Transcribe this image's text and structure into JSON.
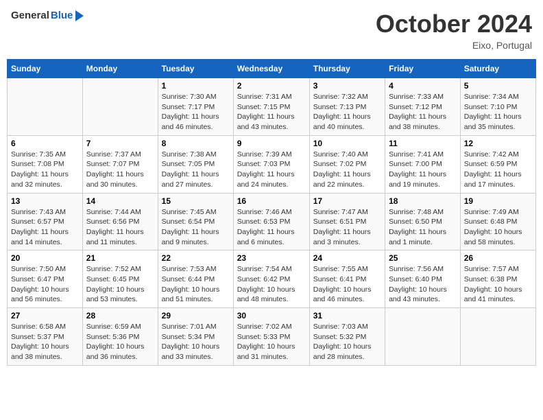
{
  "header": {
    "logo_general": "General",
    "logo_blue": "Blue",
    "title": "October 2024",
    "location": "Eixo, Portugal"
  },
  "columns": [
    "Sunday",
    "Monday",
    "Tuesday",
    "Wednesday",
    "Thursday",
    "Friday",
    "Saturday"
  ],
  "weeks": [
    [
      {
        "day": "",
        "sunrise": "",
        "sunset": "",
        "daylight": ""
      },
      {
        "day": "",
        "sunrise": "",
        "sunset": "",
        "daylight": ""
      },
      {
        "day": "1",
        "sunrise": "Sunrise: 7:30 AM",
        "sunset": "Sunset: 7:17 PM",
        "daylight": "Daylight: 11 hours and 46 minutes."
      },
      {
        "day": "2",
        "sunrise": "Sunrise: 7:31 AM",
        "sunset": "Sunset: 7:15 PM",
        "daylight": "Daylight: 11 hours and 43 minutes."
      },
      {
        "day": "3",
        "sunrise": "Sunrise: 7:32 AM",
        "sunset": "Sunset: 7:13 PM",
        "daylight": "Daylight: 11 hours and 40 minutes."
      },
      {
        "day": "4",
        "sunrise": "Sunrise: 7:33 AM",
        "sunset": "Sunset: 7:12 PM",
        "daylight": "Daylight: 11 hours and 38 minutes."
      },
      {
        "day": "5",
        "sunrise": "Sunrise: 7:34 AM",
        "sunset": "Sunset: 7:10 PM",
        "daylight": "Daylight: 11 hours and 35 minutes."
      }
    ],
    [
      {
        "day": "6",
        "sunrise": "Sunrise: 7:35 AM",
        "sunset": "Sunset: 7:08 PM",
        "daylight": "Daylight: 11 hours and 32 minutes."
      },
      {
        "day": "7",
        "sunrise": "Sunrise: 7:37 AM",
        "sunset": "Sunset: 7:07 PM",
        "daylight": "Daylight: 11 hours and 30 minutes."
      },
      {
        "day": "8",
        "sunrise": "Sunrise: 7:38 AM",
        "sunset": "Sunset: 7:05 PM",
        "daylight": "Daylight: 11 hours and 27 minutes."
      },
      {
        "day": "9",
        "sunrise": "Sunrise: 7:39 AM",
        "sunset": "Sunset: 7:03 PM",
        "daylight": "Daylight: 11 hours and 24 minutes."
      },
      {
        "day": "10",
        "sunrise": "Sunrise: 7:40 AM",
        "sunset": "Sunset: 7:02 PM",
        "daylight": "Daylight: 11 hours and 22 minutes."
      },
      {
        "day": "11",
        "sunrise": "Sunrise: 7:41 AM",
        "sunset": "Sunset: 7:00 PM",
        "daylight": "Daylight: 11 hours and 19 minutes."
      },
      {
        "day": "12",
        "sunrise": "Sunrise: 7:42 AM",
        "sunset": "Sunset: 6:59 PM",
        "daylight": "Daylight: 11 hours and 17 minutes."
      }
    ],
    [
      {
        "day": "13",
        "sunrise": "Sunrise: 7:43 AM",
        "sunset": "Sunset: 6:57 PM",
        "daylight": "Daylight: 11 hours and 14 minutes."
      },
      {
        "day": "14",
        "sunrise": "Sunrise: 7:44 AM",
        "sunset": "Sunset: 6:56 PM",
        "daylight": "Daylight: 11 hours and 11 minutes."
      },
      {
        "day": "15",
        "sunrise": "Sunrise: 7:45 AM",
        "sunset": "Sunset: 6:54 PM",
        "daylight": "Daylight: 11 hours and 9 minutes."
      },
      {
        "day": "16",
        "sunrise": "Sunrise: 7:46 AM",
        "sunset": "Sunset: 6:53 PM",
        "daylight": "Daylight: 11 hours and 6 minutes."
      },
      {
        "day": "17",
        "sunrise": "Sunrise: 7:47 AM",
        "sunset": "Sunset: 6:51 PM",
        "daylight": "Daylight: 11 hours and 3 minutes."
      },
      {
        "day": "18",
        "sunrise": "Sunrise: 7:48 AM",
        "sunset": "Sunset: 6:50 PM",
        "daylight": "Daylight: 11 hours and 1 minute."
      },
      {
        "day": "19",
        "sunrise": "Sunrise: 7:49 AM",
        "sunset": "Sunset: 6:48 PM",
        "daylight": "Daylight: 10 hours and 58 minutes."
      }
    ],
    [
      {
        "day": "20",
        "sunrise": "Sunrise: 7:50 AM",
        "sunset": "Sunset: 6:47 PM",
        "daylight": "Daylight: 10 hours and 56 minutes."
      },
      {
        "day": "21",
        "sunrise": "Sunrise: 7:52 AM",
        "sunset": "Sunset: 6:45 PM",
        "daylight": "Daylight: 10 hours and 53 minutes."
      },
      {
        "day": "22",
        "sunrise": "Sunrise: 7:53 AM",
        "sunset": "Sunset: 6:44 PM",
        "daylight": "Daylight: 10 hours and 51 minutes."
      },
      {
        "day": "23",
        "sunrise": "Sunrise: 7:54 AM",
        "sunset": "Sunset: 6:42 PM",
        "daylight": "Daylight: 10 hours and 48 minutes."
      },
      {
        "day": "24",
        "sunrise": "Sunrise: 7:55 AM",
        "sunset": "Sunset: 6:41 PM",
        "daylight": "Daylight: 10 hours and 46 minutes."
      },
      {
        "day": "25",
        "sunrise": "Sunrise: 7:56 AM",
        "sunset": "Sunset: 6:40 PM",
        "daylight": "Daylight: 10 hours and 43 minutes."
      },
      {
        "day": "26",
        "sunrise": "Sunrise: 7:57 AM",
        "sunset": "Sunset: 6:38 PM",
        "daylight": "Daylight: 10 hours and 41 minutes."
      }
    ],
    [
      {
        "day": "27",
        "sunrise": "Sunrise: 6:58 AM",
        "sunset": "Sunset: 5:37 PM",
        "daylight": "Daylight: 10 hours and 38 minutes."
      },
      {
        "day": "28",
        "sunrise": "Sunrise: 6:59 AM",
        "sunset": "Sunset: 5:36 PM",
        "daylight": "Daylight: 10 hours and 36 minutes."
      },
      {
        "day": "29",
        "sunrise": "Sunrise: 7:01 AM",
        "sunset": "Sunset: 5:34 PM",
        "daylight": "Daylight: 10 hours and 33 minutes."
      },
      {
        "day": "30",
        "sunrise": "Sunrise: 7:02 AM",
        "sunset": "Sunset: 5:33 PM",
        "daylight": "Daylight: 10 hours and 31 minutes."
      },
      {
        "day": "31",
        "sunrise": "Sunrise: 7:03 AM",
        "sunset": "Sunset: 5:32 PM",
        "daylight": "Daylight: 10 hours and 28 minutes."
      },
      {
        "day": "",
        "sunrise": "",
        "sunset": "",
        "daylight": ""
      },
      {
        "day": "",
        "sunrise": "",
        "sunset": "",
        "daylight": ""
      }
    ]
  ]
}
